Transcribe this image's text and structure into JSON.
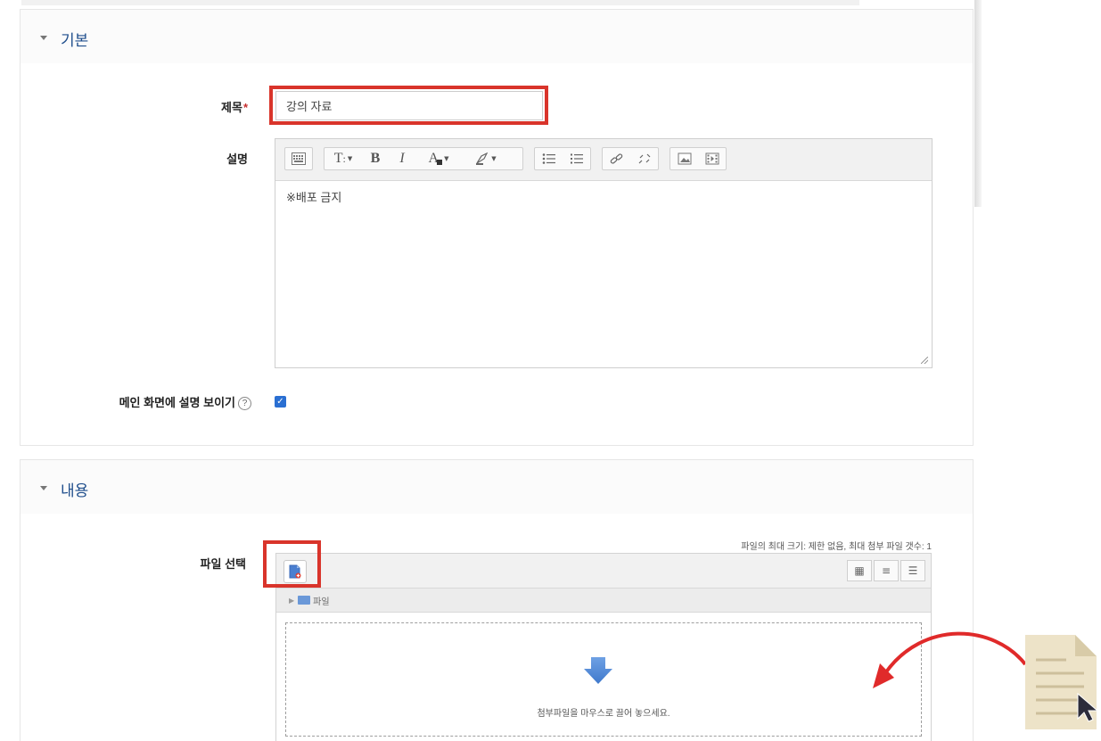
{
  "sections": {
    "basic": {
      "title": "기본"
    },
    "content": {
      "title": "내용"
    }
  },
  "fields": {
    "title": {
      "label": "제목",
      "required_mark": "*",
      "value": "강의 자료"
    },
    "description": {
      "label": "설명",
      "body": "※배포 금지",
      "toolbar": [
        "toggle-toolbar-icon",
        "paragraph-style",
        "bold",
        "italic",
        "text-color",
        "background-color",
        "bullet-list",
        "numbered-list",
        "link",
        "unlink",
        "insert-image",
        "insert-media"
      ]
    },
    "show_description": {
      "label": "메인 화면에 설명 보이기",
      "help": "?",
      "checked": true
    },
    "file_select": {
      "label": "파일 선택",
      "limits": "파일의 최대 크기: 제한 없음, 최대 첨부 파일 갯수: 1",
      "path_folder": "파일",
      "drop_message": "첨부파일을 마우스로 끌어 놓으세요."
    }
  },
  "colors": {
    "accent": "#1f4e8c",
    "highlight": "#d9342b",
    "checkbox": "#2a6fd2",
    "drop_arrow": "#4a86d4",
    "curve_arrow": "#e02a2a",
    "doc_icon": "#ede3c8"
  }
}
